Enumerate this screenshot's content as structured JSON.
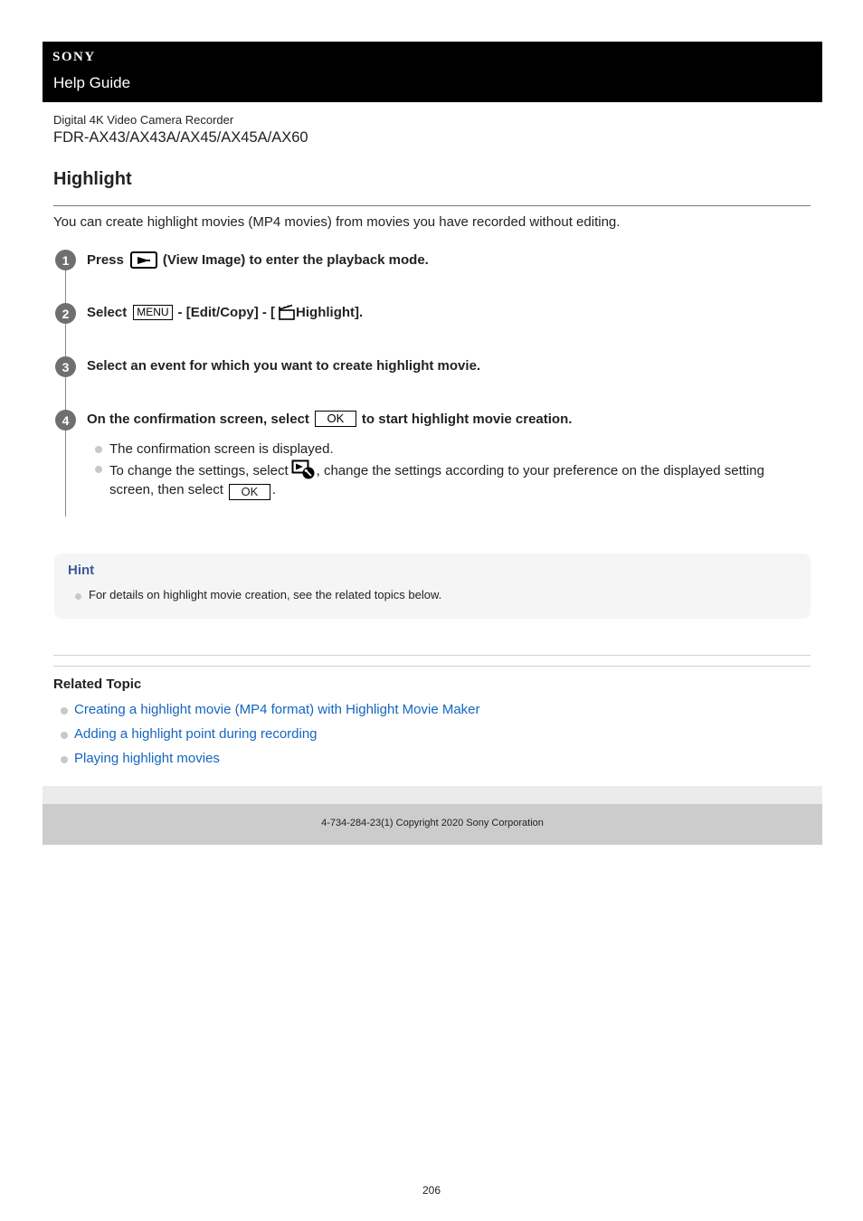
{
  "header": {
    "brand": "SONY",
    "title": "Help Guide"
  },
  "product": {
    "type": "Digital 4K Video Camera Recorder",
    "models": "FDR-AX43/AX43A/AX45/AX45A/AX60"
  },
  "page": {
    "title": "Highlight",
    "intro": "You can create highlight movies (MP4 movies) from movies you have recorded without editing."
  },
  "steps": [
    {
      "number": "1",
      "pre": "Press",
      "icon": "view-image-icon",
      "post": "(View Image) to enter the playback mode."
    },
    {
      "number": "2",
      "pre": "Select",
      "menu_label": "MENU",
      "mid": "- [Edit/Copy] - [",
      "icon": "highlight-clapper-icon",
      "post": "Highlight]."
    },
    {
      "number": "3",
      "text": "Select an event for which you want to create highlight movie."
    },
    {
      "number": "4",
      "pre": "On the confirmation screen, select",
      "button_label": "OK",
      "post": "to start highlight movie creation.",
      "bullets": [
        {
          "text": "The confirmation screen is displayed."
        },
        {
          "pre": "To change the settings, select",
          "icon": "playback-settings-icon",
          "mid": ", change the settings according to your preference on the displayed setting screen, then select",
          "button_label": "OK",
          "post": "."
        }
      ]
    }
  ],
  "hint": {
    "title": "Hint",
    "items": [
      "For details on highlight movie creation, see the related topics below."
    ]
  },
  "related": {
    "title": "Related Topic",
    "links": [
      "Creating a highlight movie (MP4 format) with Highlight Movie Maker",
      "Adding a highlight point during recording",
      "Playing highlight movies"
    ]
  },
  "footer": {
    "copyright": "4-734-284-23(1) Copyright 2020 Sony Corporation"
  },
  "page_number": "206",
  "colors": {
    "header_bg": "#000000",
    "hint_title": "#3c5a97",
    "link": "#1466c0",
    "step_badge": "#6f6f6f",
    "footer_bg": "#cccccc"
  }
}
